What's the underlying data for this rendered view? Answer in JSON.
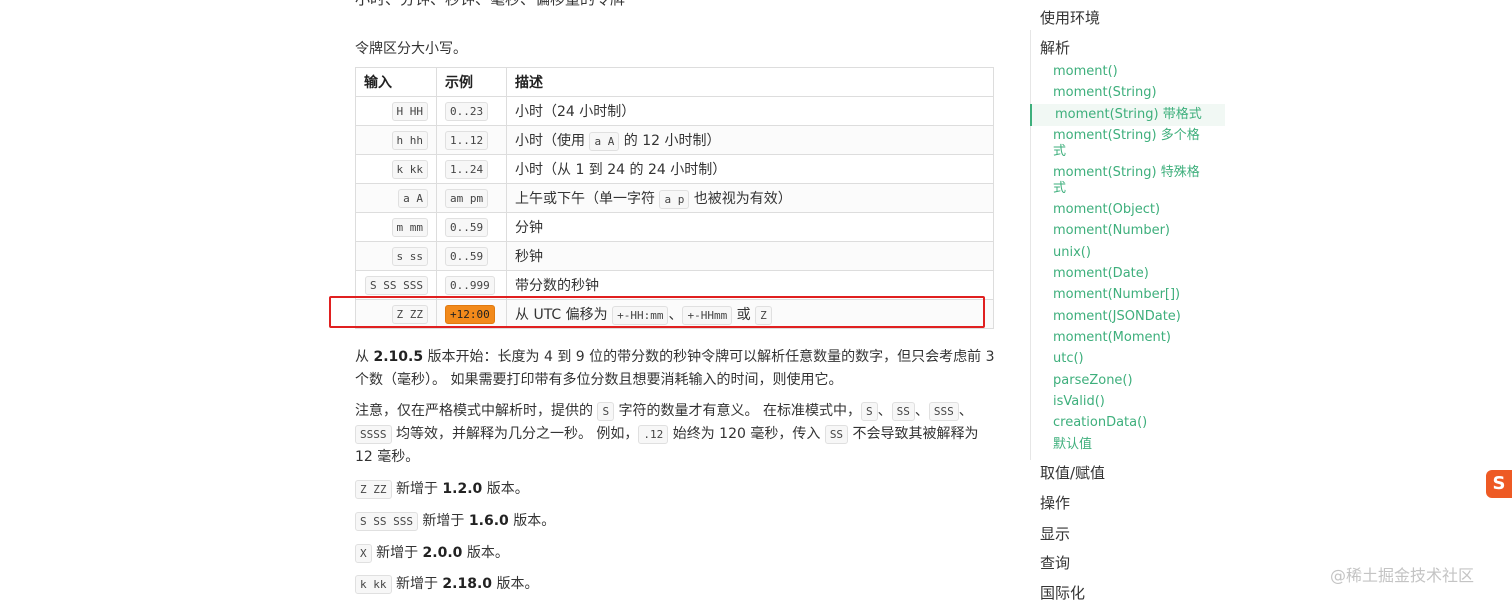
{
  "section": {
    "heading_cut": "小时、分钟、秒钟、毫秒、偏移量的令牌",
    "intro": "令牌区分大小写。"
  },
  "table": {
    "headers": [
      "输入",
      "示例",
      "描述"
    ],
    "rows": [
      {
        "input": "H HH",
        "example": "0..23",
        "desc": "小时（24 小时制）"
      },
      {
        "input": "h hh",
        "example": "1..12",
        "desc_pre": "小时（使用 ",
        "desc_code": "a A",
        "desc_post": " 的 12 小时制）"
      },
      {
        "input": "k kk",
        "example": "1..24",
        "desc": "小时（从 1 到 24 的 24 小时制）"
      },
      {
        "input": "a A",
        "example": "am pm",
        "desc_pre": "上午或下午（单一字符 ",
        "desc_code": "a p",
        "desc_post": " 也被视为有效）"
      },
      {
        "input": "m mm",
        "example": "0..59",
        "desc": "分钟"
      },
      {
        "input": "s ss",
        "example": "0..59",
        "desc": "秒钟"
      },
      {
        "input": "S SS SSS",
        "example": "0..999",
        "desc": "带分数的秒钟"
      },
      {
        "input": "Z ZZ",
        "example": "+12:00",
        "desc_pre": "从 UTC 偏移为 ",
        "code1": "+-HH:mm",
        "sep1": "、",
        "code2": "+-HHmm",
        "sep2": " 或 ",
        "code3": "Z"
      }
    ]
  },
  "paras": {
    "p1_a": "从 ",
    "p1_b": "2.10.5",
    "p1_c": " 版本开始：长度为 4 到 9 位的带分数的秒钟令牌可以解析任意数量的数字，但只会考虑前 3 个数（毫秒）。 如果需要打印带有多位分数且想要消耗输入的时间，则使用它。",
    "p2_a": "注意，仅在严格模式中解析时，提供的 ",
    "p2_code1": "S",
    "p2_b": " 字符的数量才有意义。 在标准模式中，",
    "p2_code2": "S",
    "p2_sep1": "、",
    "p2_code3": "SS",
    "p2_sep2": "、",
    "p2_code4": "SSS",
    "p2_sep3": "、",
    "p2_code5": "SSSS",
    "p2_c": " 均等效，并解释为几分之一秒。 例如，",
    "p2_code6": ".12",
    "p2_d": " 始终为 120 毫秒，传入 ",
    "p2_code7": "SS",
    "p2_e": " 不会导致其被解释为 12 毫秒。",
    "added": [
      {
        "code": "Z ZZ",
        "text": " 新增于 ",
        "version": "1.2.0",
        "suffix": " 版本。"
      },
      {
        "code": "S SS SSS",
        "text": " 新增于 ",
        "version": "1.6.0",
        "suffix": " 版本。"
      },
      {
        "code": "X",
        "text": " 新增于 ",
        "version": "2.0.0",
        "suffix": " 版本。"
      },
      {
        "code": "k kk",
        "text": " 新增于 ",
        "version": "2.18.0",
        "suffix": " 版本。"
      }
    ]
  },
  "toc": {
    "usage_env": "使用环境",
    "parse": "解析",
    "parse_items": [
      "moment()",
      "moment(String)",
      "moment(String) 带格式",
      "moment(String) 多个格式",
      "moment(String) 特殊格式",
      "moment(Object)",
      "moment(Number)",
      "unix()",
      "moment(Date)",
      "moment(Number[])",
      "moment(JSONDate)",
      "moment(Moment)",
      "utc()",
      "parseZone()",
      "isValid()",
      "creationData()",
      "默认值"
    ],
    "sections": [
      "取值/赋值",
      "操作",
      "显示",
      "查询",
      "国际化"
    ]
  },
  "overlay": {
    "sogou_letter": "S",
    "watermark": "@稀土掘金技术社区"
  },
  "colors": {
    "accent": "#3eaf7c",
    "highlight_box": "#e02020",
    "code_highlight": "#f28a1b"
  }
}
